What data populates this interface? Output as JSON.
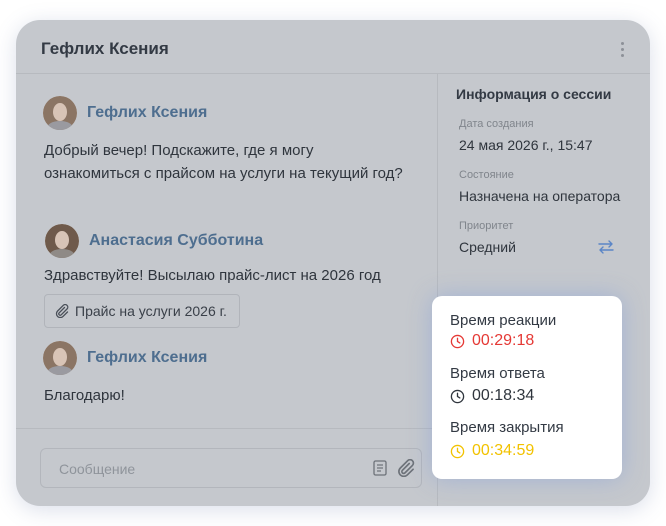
{
  "header": {
    "title": "Гефлих Ксения"
  },
  "messages": [
    {
      "author": "Гефлих Ксения",
      "text": "Добрый вечер! Подскажите, где я могу ознакомиться с прайсом на услуги на текущий год?"
    },
    {
      "author": "Анастасия Субботина",
      "text": "Здравствуйте! Высылаю прайс-лист на 2026 год",
      "attachment": "Прайс на услуги 2026 г."
    },
    {
      "author": "Гефлих Ксения",
      "text": "Благодарю!"
    }
  ],
  "composer": {
    "placeholder": "Сообщение"
  },
  "session": {
    "title": "Информация о сессии",
    "created_label": "Дата создания",
    "created_value": "24 мая 2026 г., 15:47",
    "status_label": "Состояние",
    "status_value": "Назначена на оператора",
    "priority_label": "Приоритет",
    "priority_value": "Средний"
  },
  "timers": [
    {
      "label": "Время реакции",
      "value": "00:29:18",
      "color": "#e53935"
    },
    {
      "label": "Время ответа",
      "value": "00:18:34",
      "color": "#2f353d"
    },
    {
      "label": "Время закрытия",
      "value": "00:34:59",
      "color": "#f2c200"
    }
  ],
  "colors": {
    "author": "#4e6e8f",
    "overlay": "#c5c8cd",
    "swap_icon": "#5b86c7"
  }
}
